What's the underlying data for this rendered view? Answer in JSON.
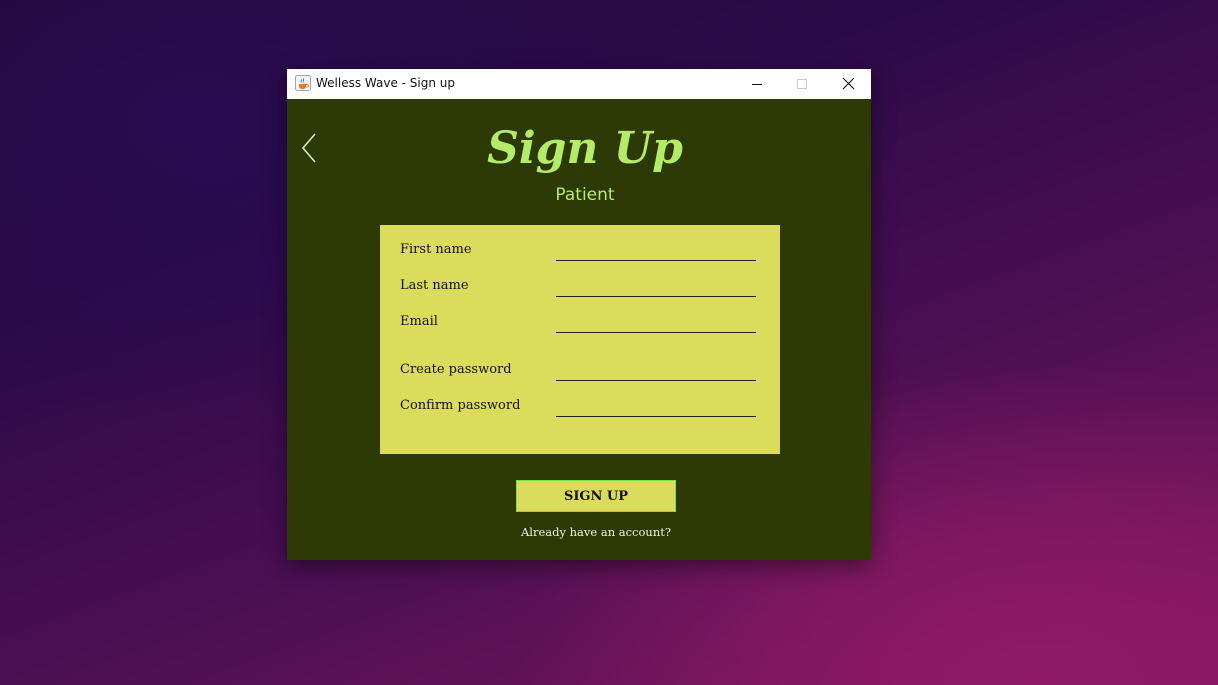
{
  "window": {
    "title": "Welless Wave - Sign up",
    "icon": "java-cup-icon"
  },
  "titlebar_controls": {
    "minimize_icon": "minimize-icon",
    "maximize_icon": "maximize-icon",
    "close_icon": "close-icon"
  },
  "header": {
    "back_icon": "chevron-left-icon",
    "title": "Sign Up",
    "subtitle": "Patient"
  },
  "form": {
    "fields": [
      {
        "label": "First name",
        "value": "",
        "placeholder": ""
      },
      {
        "label": "Last name",
        "value": "",
        "placeholder": ""
      },
      {
        "label": "Email",
        "value": "",
        "placeholder": ""
      },
      {
        "label": "Create password",
        "value": "",
        "placeholder": ""
      },
      {
        "label": "Confirm password",
        "value": "",
        "placeholder": ""
      }
    ]
  },
  "actions": {
    "signup_label": "SIGN UP",
    "login_link": "Already have an account?"
  },
  "colors": {
    "content_background": "#2e3a06",
    "accent_green": "#b4ec6a",
    "form_panel": "#dcdc5c",
    "button_border": "#7ee04a"
  }
}
